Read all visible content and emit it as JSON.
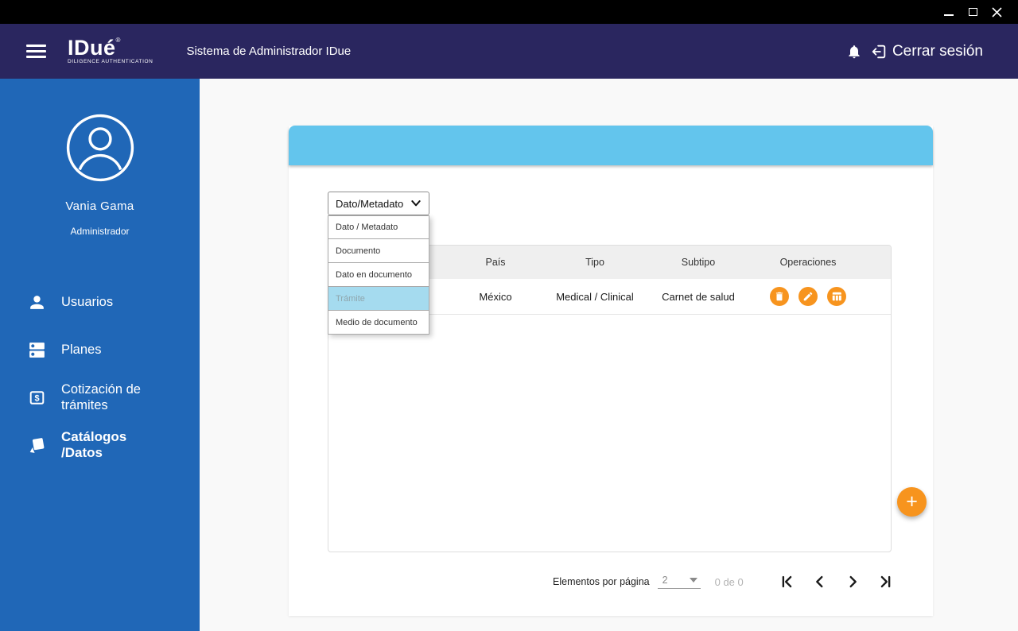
{
  "colors": {
    "titlebar": "#000000",
    "appbar": "#2A265F",
    "sidebar": "#2067B7",
    "band": "#63C5ED",
    "accent_orange": "#F7941E",
    "option_highlight": "#A5DBEF",
    "table_header_bg": "#EFEFEF"
  },
  "appbar": {
    "logo_text": "IDué",
    "logo_mark": "®",
    "logo_subtitle": "DILIGENCE AUTHENTICATION",
    "app_title": "Sistema de Administrador IDue",
    "logout_label": "Cerrar sesión"
  },
  "sidebar": {
    "user_name": "Vania Gama",
    "user_role": "Administrador",
    "items": [
      {
        "label": "Usuarios",
        "active": false
      },
      {
        "label": "Planes",
        "active": false
      },
      {
        "label": "Cotización de trámites",
        "active": false
      },
      {
        "label": "Catálogos /Datos",
        "active": true
      }
    ]
  },
  "content": {
    "filter": {
      "value": "Dato/Metadato",
      "options": [
        "Dato / Metadato",
        "Documento",
        "Dato en documento",
        "Trámite",
        "Medio de documento"
      ],
      "highlighted_option": "Trámite"
    },
    "table": {
      "columns": [
        "País",
        "Tipo",
        "Subtipo",
        "Operaciones"
      ],
      "rows": [
        {
          "pais": "México",
          "tipo": "Medical / Clinical",
          "subtipo": "Carnet de salud"
        }
      ],
      "row_operations": [
        "delete",
        "edit",
        "columns"
      ]
    },
    "fab_label": "+",
    "pagination": {
      "items_label": "Elementos por página",
      "per_page": "2",
      "range": "0 de 0"
    }
  }
}
